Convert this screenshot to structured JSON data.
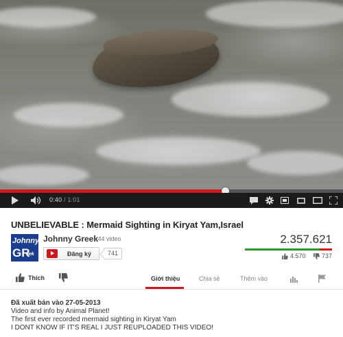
{
  "video": {
    "current_time": "0:40",
    "separator": "/",
    "duration": "1:01",
    "progress_fraction": 0.656
  },
  "title": "UNBELIEVABLE : Mermaid Sighting in Kiryat Yam,Israel",
  "channel": {
    "name": "Johnny Greek",
    "video_count": "· 44 video",
    "avatar_text_top": "Johnny",
    "avatar_text_main": "GR",
    "avatar_text_sub": "eek",
    "subscribe_label": "Đăng ký",
    "subscriber_count": "741"
  },
  "stats": {
    "views": "2.357.621",
    "likes": "4.570",
    "dislikes": "737",
    "like_fraction": 0.861
  },
  "actions": {
    "like_label": "Thích"
  },
  "tabs": [
    {
      "label": "Giới thiệu",
      "active": true
    },
    {
      "label": "Chia sẻ",
      "active": false
    },
    {
      "label": "Thêm vào",
      "active": false
    }
  ],
  "description": {
    "published": "Đã xuất bản vào 27-05-2013",
    "lines": [
      "Video and info by Animal Planet!",
      "The first ever recorded mermaid sighting in Kiryat Yam",
      "I DONT KNOW IF IT'S REAL I JUST REUPLOADED THIS VIDEO!"
    ]
  },
  "colors": {
    "progress_red": "#cc181e",
    "like_green": "#2b9a2b",
    "channel_blue": "#1b3d8f"
  }
}
